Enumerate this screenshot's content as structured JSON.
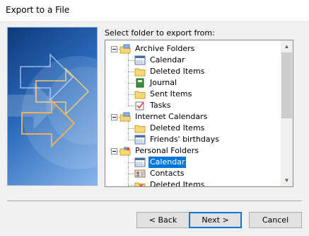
{
  "window": {
    "title": "Export to a File"
  },
  "prompt": "Select folder to export from:",
  "tree": [
    {
      "label": "Archive Folders",
      "level": 0,
      "icon": "archive-folder-icon",
      "expanded": true
    },
    {
      "label": "Calendar",
      "level": 1,
      "icon": "calendar-icon"
    },
    {
      "label": "Deleted Items",
      "level": 1,
      "icon": "folder-icon"
    },
    {
      "label": "Journal",
      "level": 1,
      "icon": "journal-icon"
    },
    {
      "label": "Sent Items",
      "level": 1,
      "icon": "folder-icon"
    },
    {
      "label": "Tasks",
      "level": 1,
      "icon": "tasks-icon"
    },
    {
      "label": "Internet Calendars",
      "level": 0,
      "icon": "archive-folder-icon",
      "expanded": true
    },
    {
      "label": "Deleted Items",
      "level": 1,
      "icon": "folder-icon"
    },
    {
      "label": "Friends' birthdays",
      "level": 1,
      "icon": "calendar-icon"
    },
    {
      "label": "Personal Folders",
      "level": 0,
      "icon": "personal-folder-icon",
      "expanded": true
    },
    {
      "label": "Calendar",
      "level": 1,
      "icon": "calendar-icon",
      "selected": true
    },
    {
      "label": "Contacts",
      "level": 1,
      "icon": "contacts-icon"
    },
    {
      "label": "Deleted Items",
      "level": 1,
      "icon": "deleted-items-icon"
    }
  ],
  "buttons": {
    "back": "< Back",
    "next": "Next >",
    "cancel": "Cancel"
  },
  "colors": {
    "selection": "#0078d7",
    "accent": "#0078d7"
  }
}
